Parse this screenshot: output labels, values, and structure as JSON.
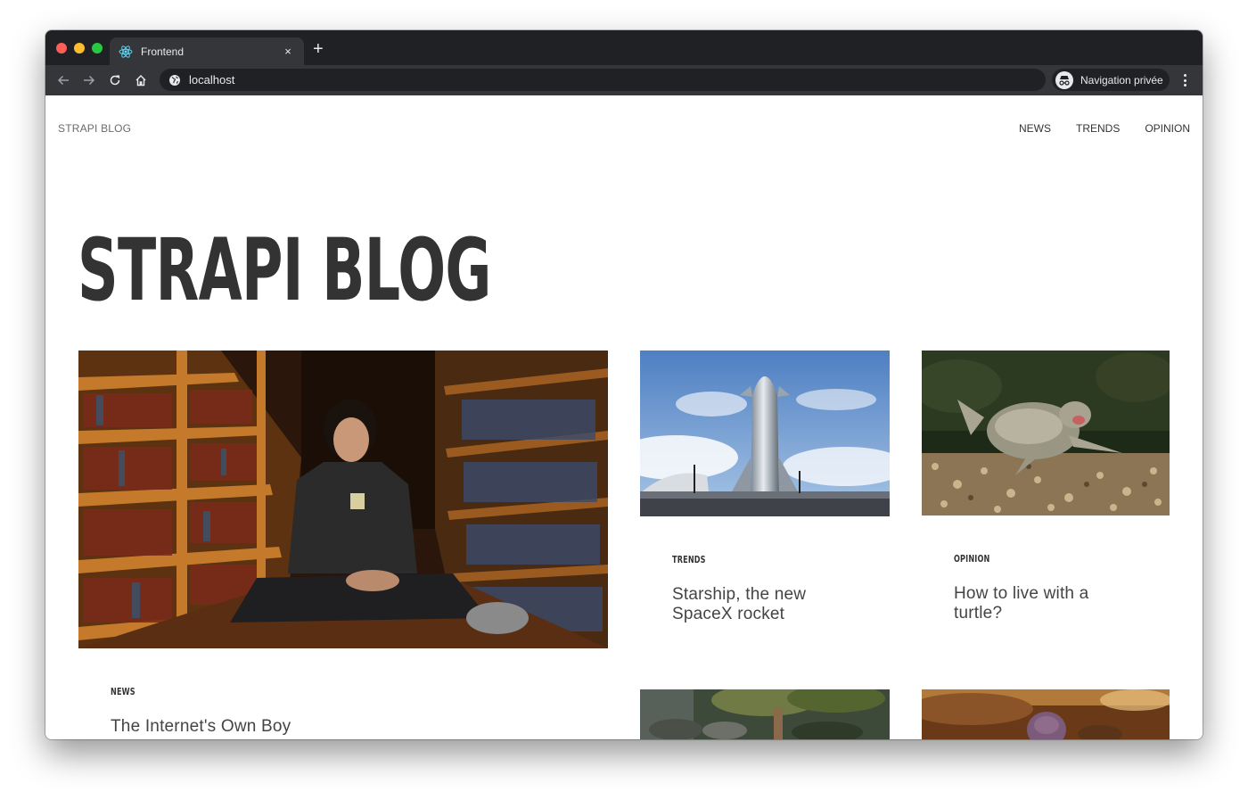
{
  "browser": {
    "tab_title": "Frontend",
    "tab_close": "×",
    "new_tab": "+",
    "url": "localhost",
    "incognito_label": "Navigation privée",
    "traffic_colors": [
      "#ff5f57",
      "#febc2e",
      "#28c840"
    ]
  },
  "site": {
    "logo": "STRAPI BLOG",
    "nav": [
      "NEWS",
      "TRENDS",
      "OPINION"
    ],
    "hero_title": "STRAPI BLOG"
  },
  "articles": [
    {
      "category": "NEWS",
      "title": "The Internet's Own Boy",
      "image": "man-in-bookstore-photo"
    },
    {
      "category": "TRENDS",
      "title_lines": [
        "Starship, the new",
        "SpaceX rocket"
      ],
      "image": "starship-rocket-photo"
    },
    {
      "category": "OPINION",
      "title_lines": [
        "How to live with a",
        "turtle?"
      ],
      "image": "turtle-photo"
    },
    {
      "image": "dinosaur-jungle-photo"
    },
    {
      "image": "thanos-photo"
    }
  ]
}
